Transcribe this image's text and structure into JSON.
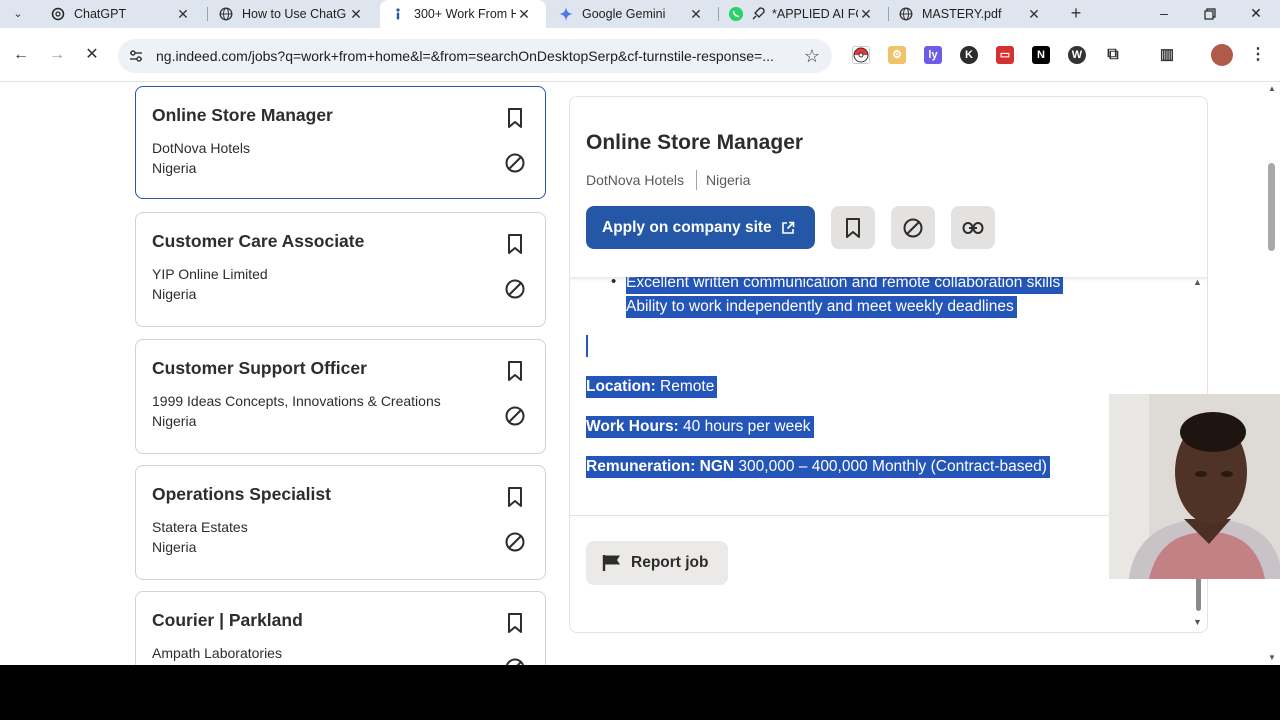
{
  "browser": {
    "tabs": [
      {
        "title": "ChatGPT",
        "icon": "chatgpt-icon"
      },
      {
        "title": "How to Use ChatG",
        "icon": "globe-icon"
      },
      {
        "title": "300+ Work From H",
        "icon": "indeed-icon",
        "active": true
      },
      {
        "title": "Google Gemini",
        "icon": "gemini-icon"
      },
      {
        "title": "*APPLIED AI FO",
        "icon": "whatsapp-icon"
      },
      {
        "title": "MASTERY.pdf",
        "icon": "globe-icon"
      }
    ],
    "url": "ng.indeed.com/jobs?q=work+from+home&l=&from=searchOnDesktopSerp&cf-turnstile-response=..."
  },
  "job_list": [
    {
      "title": "Online Store Manager",
      "company": "DotNova Hotels",
      "location": "Nigeria"
    },
    {
      "title": "Customer Care Associate",
      "company": "YIP Online Limited",
      "location": "Nigeria"
    },
    {
      "title": "Customer Support Officer",
      "company": "1999 Ideas Concepts, Innovations & Creations",
      "location": "Nigeria"
    },
    {
      "title": "Operations Specialist",
      "company": "Statera Estates",
      "location": "Nigeria"
    },
    {
      "title": "Courier | Parkland",
      "company": "Ampath Laboratories",
      "location": ""
    }
  ],
  "detail": {
    "title": "Online Store Manager",
    "company": "DotNova Hotels",
    "location": "Nigeria",
    "apply_label": "Apply on company site",
    "bullets": [
      "Excellent written communication and remote collaboration skills",
      "Ability to work independently and meet weekly deadlines"
    ],
    "location_label": "Location:",
    "location_value": " Remote",
    "hours_label": "Work Hours:",
    "hours_value": " 40 hours per week",
    "pay_label": "Remuneration: NGN",
    "pay_value": " 300,000 – 400,000 Monthly (Contract-based)",
    "report_label": "Report job"
  },
  "colors": {
    "brand_blue": "#2557a7",
    "selection": "#2455b8"
  }
}
